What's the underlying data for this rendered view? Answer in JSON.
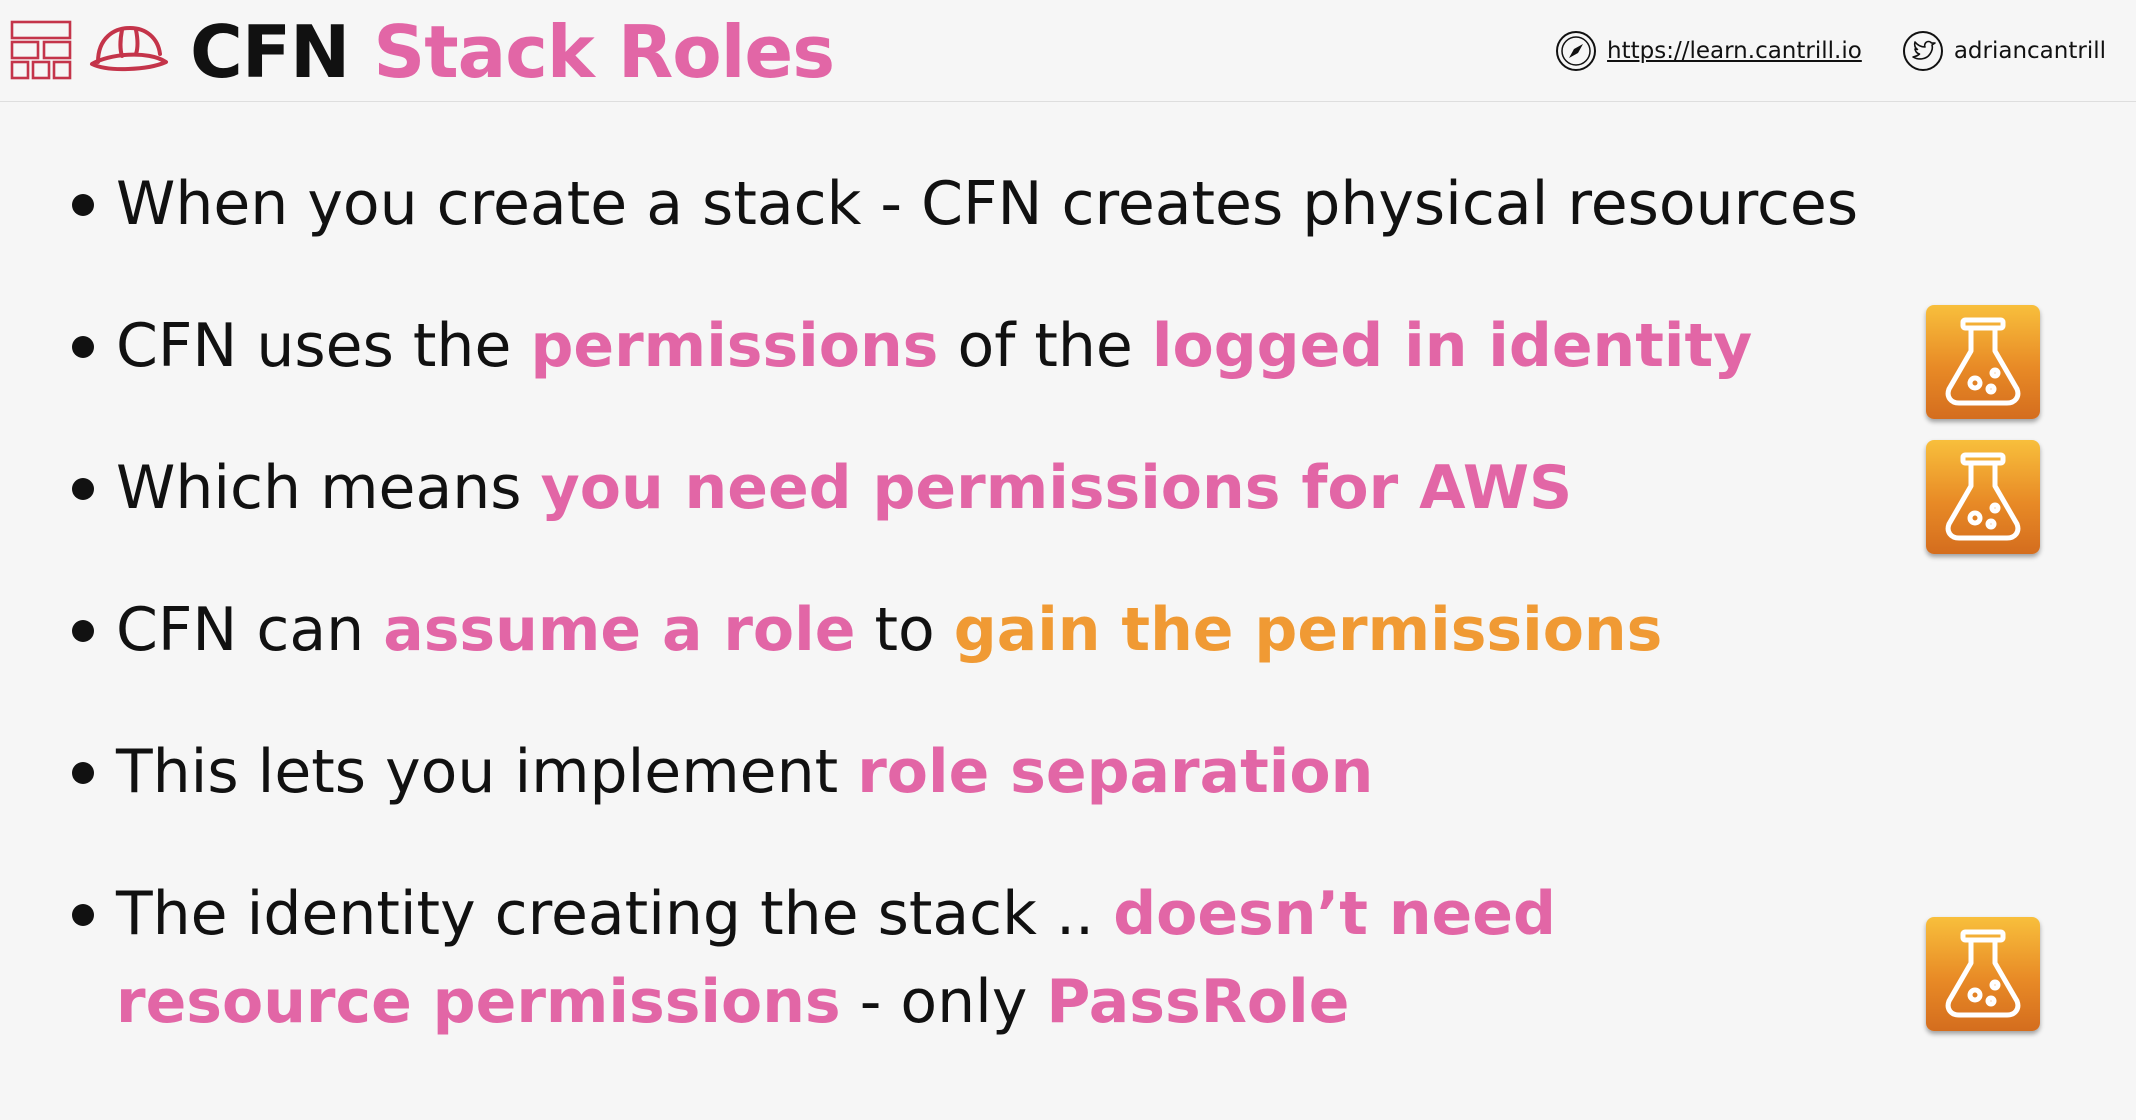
{
  "header": {
    "title_plain": "CFN",
    "title_accent": "Stack Roles",
    "website_url": "https://learn.cantrill.io",
    "twitter_handle": "adriancantrill",
    "website_icon": "compass-icon",
    "twitter_icon": "twitter-bird-icon",
    "layout_icon": "layout-grid-icon",
    "logo_icon": "hard-hat-icon"
  },
  "colors": {
    "accent_pink": "#e266a6",
    "accent_orange": "#f09a34",
    "text": "#111111",
    "background": "#f6f6f6",
    "lab_icon": "#ec9a2c"
  },
  "bullets": [
    {
      "parts": [
        {
          "text": "When you create a stack - CFN creates physical resources",
          "style": "plain"
        }
      ]
    },
    {
      "parts": [
        {
          "text": "CFN uses the ",
          "style": "plain"
        },
        {
          "text": "permissions",
          "style": "pink"
        },
        {
          "text": " of the ",
          "style": "plain"
        },
        {
          "text": "logged in identity",
          "style": "pink"
        }
      ],
      "lab_icon": true
    },
    {
      "parts": [
        {
          "text": "Which means ",
          "style": "plain"
        },
        {
          "text": "you need permissions for AWS",
          "style": "pink"
        }
      ],
      "lab_icon": true
    },
    {
      "parts": [
        {
          "text": "CFN can ",
          "style": "plain"
        },
        {
          "text": "assume a role",
          "style": "pink"
        },
        {
          "text": " to ",
          "style": "plain"
        },
        {
          "text": "gain the permissions",
          "style": "orange"
        }
      ]
    },
    {
      "parts": [
        {
          "text": "This lets you implement ",
          "style": "plain"
        },
        {
          "text": "role separation",
          "style": "pink"
        }
      ]
    },
    {
      "parts": [
        {
          "text": "The identity creating the stack .. ",
          "style": "plain"
        },
        {
          "text": "doesn’t need resource permissions",
          "style": "pink"
        },
        {
          "text": " - only ",
          "style": "plain"
        },
        {
          "text": "PassRole",
          "style": "pink"
        }
      ],
      "lab_icon": true
    }
  ],
  "icons": {
    "lab": "lab-flask-icon"
  }
}
